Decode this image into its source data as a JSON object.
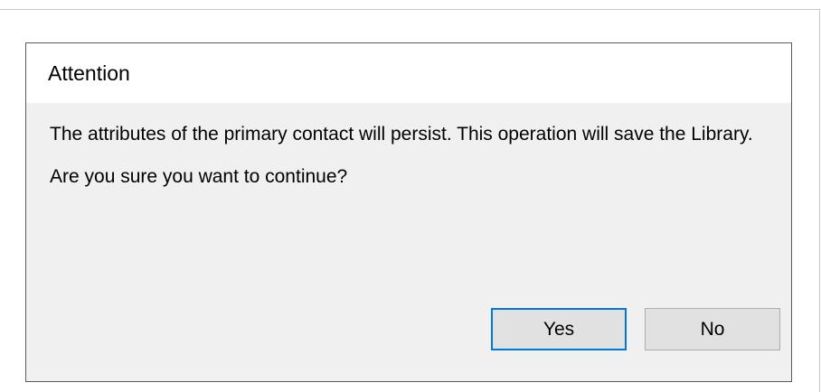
{
  "dialog": {
    "title": "Attention",
    "message": "The attributes of the primary contact will persist.  This operation will save the Library.",
    "question": "Are you sure you want to continue?",
    "buttons": {
      "yes_label": "Yes",
      "no_label": "No"
    },
    "colors": {
      "default_button_border": "#0078d7",
      "background": "#f0f0f0",
      "titlebar": "#ffffff"
    }
  }
}
